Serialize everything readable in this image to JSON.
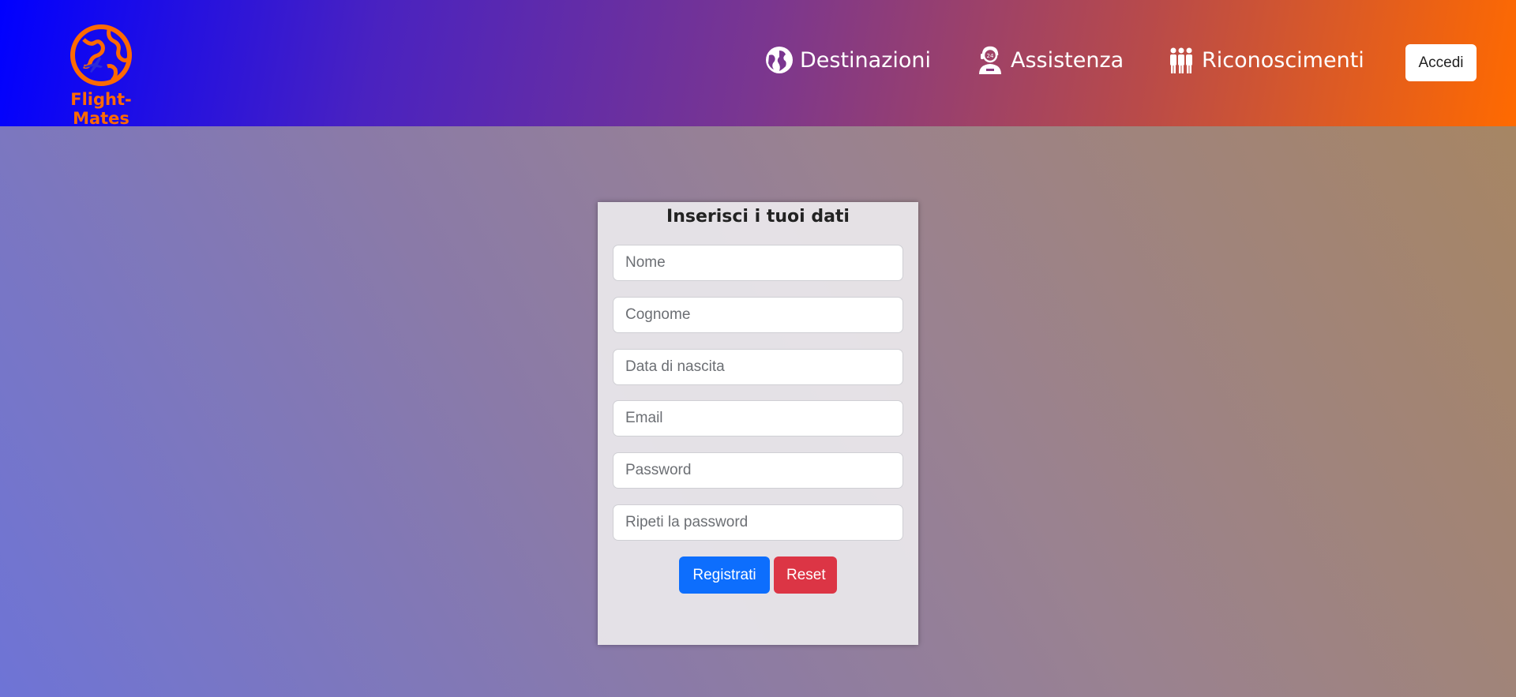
{
  "brand": {
    "name": "Flight-Mates",
    "color": "#ff6a00"
  },
  "nav": {
    "links": [
      {
        "label": "Destinazioni",
        "icon": "globe-icon"
      },
      {
        "label": "Assistenza",
        "icon": "support-agent-icon"
      },
      {
        "label": "Riconoscimenti",
        "icon": "crew-icon"
      }
    ],
    "login_label": "Accedi"
  },
  "form": {
    "title": "Inserisci i tuoi dati",
    "fields": [
      {
        "placeholder": "Nome",
        "value": ""
      },
      {
        "placeholder": "Cognome",
        "value": ""
      },
      {
        "placeholder": "Data di nascita",
        "value": ""
      },
      {
        "placeholder": "Email",
        "value": ""
      },
      {
        "placeholder": "Password",
        "value": ""
      },
      {
        "placeholder": "Ripeti la password",
        "value": ""
      }
    ],
    "submit_label": "Registrati",
    "reset_label": "Reset"
  },
  "colors": {
    "primary": "#0d6efd",
    "danger": "#dc3545"
  }
}
